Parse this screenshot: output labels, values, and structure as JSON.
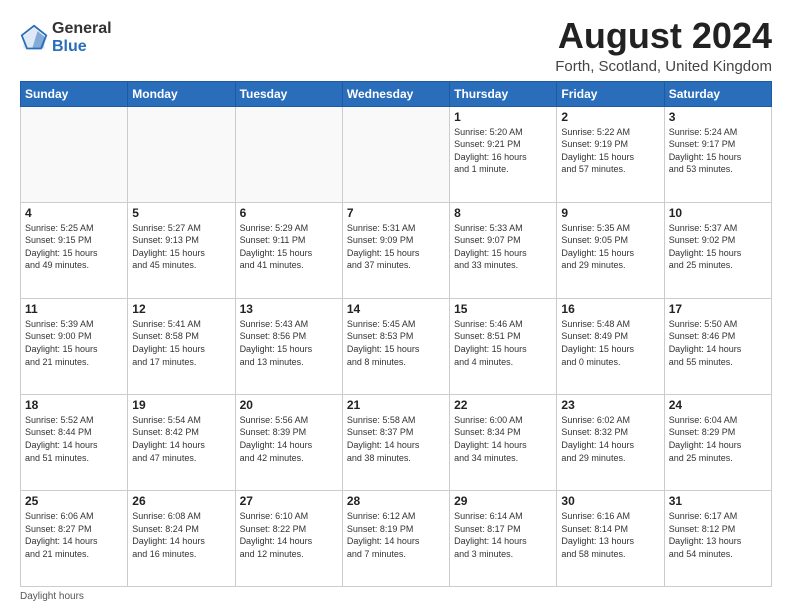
{
  "logo": {
    "general": "General",
    "blue": "Blue"
  },
  "header": {
    "month_year": "August 2024",
    "location": "Forth, Scotland, United Kingdom"
  },
  "weekdays": [
    "Sunday",
    "Monday",
    "Tuesday",
    "Wednesday",
    "Thursday",
    "Friday",
    "Saturday"
  ],
  "weeks": [
    [
      {
        "day": "",
        "info": ""
      },
      {
        "day": "",
        "info": ""
      },
      {
        "day": "",
        "info": ""
      },
      {
        "day": "",
        "info": ""
      },
      {
        "day": "1",
        "info": "Sunrise: 5:20 AM\nSunset: 9:21 PM\nDaylight: 16 hours\nand 1 minute."
      },
      {
        "day": "2",
        "info": "Sunrise: 5:22 AM\nSunset: 9:19 PM\nDaylight: 15 hours\nand 57 minutes."
      },
      {
        "day": "3",
        "info": "Sunrise: 5:24 AM\nSunset: 9:17 PM\nDaylight: 15 hours\nand 53 minutes."
      }
    ],
    [
      {
        "day": "4",
        "info": "Sunrise: 5:25 AM\nSunset: 9:15 PM\nDaylight: 15 hours\nand 49 minutes."
      },
      {
        "day": "5",
        "info": "Sunrise: 5:27 AM\nSunset: 9:13 PM\nDaylight: 15 hours\nand 45 minutes."
      },
      {
        "day": "6",
        "info": "Sunrise: 5:29 AM\nSunset: 9:11 PM\nDaylight: 15 hours\nand 41 minutes."
      },
      {
        "day": "7",
        "info": "Sunrise: 5:31 AM\nSunset: 9:09 PM\nDaylight: 15 hours\nand 37 minutes."
      },
      {
        "day": "8",
        "info": "Sunrise: 5:33 AM\nSunset: 9:07 PM\nDaylight: 15 hours\nand 33 minutes."
      },
      {
        "day": "9",
        "info": "Sunrise: 5:35 AM\nSunset: 9:05 PM\nDaylight: 15 hours\nand 29 minutes."
      },
      {
        "day": "10",
        "info": "Sunrise: 5:37 AM\nSunset: 9:02 PM\nDaylight: 15 hours\nand 25 minutes."
      }
    ],
    [
      {
        "day": "11",
        "info": "Sunrise: 5:39 AM\nSunset: 9:00 PM\nDaylight: 15 hours\nand 21 minutes."
      },
      {
        "day": "12",
        "info": "Sunrise: 5:41 AM\nSunset: 8:58 PM\nDaylight: 15 hours\nand 17 minutes."
      },
      {
        "day": "13",
        "info": "Sunrise: 5:43 AM\nSunset: 8:56 PM\nDaylight: 15 hours\nand 13 minutes."
      },
      {
        "day": "14",
        "info": "Sunrise: 5:45 AM\nSunset: 8:53 PM\nDaylight: 15 hours\nand 8 minutes."
      },
      {
        "day": "15",
        "info": "Sunrise: 5:46 AM\nSunset: 8:51 PM\nDaylight: 15 hours\nand 4 minutes."
      },
      {
        "day": "16",
        "info": "Sunrise: 5:48 AM\nSunset: 8:49 PM\nDaylight: 15 hours\nand 0 minutes."
      },
      {
        "day": "17",
        "info": "Sunrise: 5:50 AM\nSunset: 8:46 PM\nDaylight: 14 hours\nand 55 minutes."
      }
    ],
    [
      {
        "day": "18",
        "info": "Sunrise: 5:52 AM\nSunset: 8:44 PM\nDaylight: 14 hours\nand 51 minutes."
      },
      {
        "day": "19",
        "info": "Sunrise: 5:54 AM\nSunset: 8:42 PM\nDaylight: 14 hours\nand 47 minutes."
      },
      {
        "day": "20",
        "info": "Sunrise: 5:56 AM\nSunset: 8:39 PM\nDaylight: 14 hours\nand 42 minutes."
      },
      {
        "day": "21",
        "info": "Sunrise: 5:58 AM\nSunset: 8:37 PM\nDaylight: 14 hours\nand 38 minutes."
      },
      {
        "day": "22",
        "info": "Sunrise: 6:00 AM\nSunset: 8:34 PM\nDaylight: 14 hours\nand 34 minutes."
      },
      {
        "day": "23",
        "info": "Sunrise: 6:02 AM\nSunset: 8:32 PM\nDaylight: 14 hours\nand 29 minutes."
      },
      {
        "day": "24",
        "info": "Sunrise: 6:04 AM\nSunset: 8:29 PM\nDaylight: 14 hours\nand 25 minutes."
      }
    ],
    [
      {
        "day": "25",
        "info": "Sunrise: 6:06 AM\nSunset: 8:27 PM\nDaylight: 14 hours\nand 21 minutes."
      },
      {
        "day": "26",
        "info": "Sunrise: 6:08 AM\nSunset: 8:24 PM\nDaylight: 14 hours\nand 16 minutes."
      },
      {
        "day": "27",
        "info": "Sunrise: 6:10 AM\nSunset: 8:22 PM\nDaylight: 14 hours\nand 12 minutes."
      },
      {
        "day": "28",
        "info": "Sunrise: 6:12 AM\nSunset: 8:19 PM\nDaylight: 14 hours\nand 7 minutes."
      },
      {
        "day": "29",
        "info": "Sunrise: 6:14 AM\nSunset: 8:17 PM\nDaylight: 14 hours\nand 3 minutes."
      },
      {
        "day": "30",
        "info": "Sunrise: 6:16 AM\nSunset: 8:14 PM\nDaylight: 13 hours\nand 58 minutes."
      },
      {
        "day": "31",
        "info": "Sunrise: 6:17 AM\nSunset: 8:12 PM\nDaylight: 13 hours\nand 54 minutes."
      }
    ]
  ],
  "footer": {
    "label": "Daylight hours"
  }
}
